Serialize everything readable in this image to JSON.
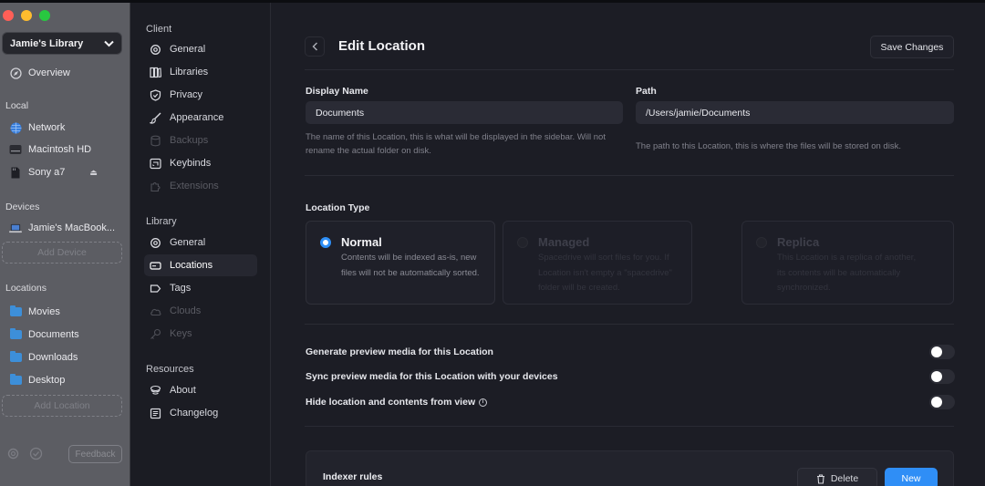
{
  "sidebar": {
    "library_name": "Jamie's Library",
    "overview": "Overview",
    "local_heading": "Local",
    "local_items": [
      "Network",
      "Macintosh HD",
      "Sony a7"
    ],
    "devices_heading": "Devices",
    "device_name": "Jamie's MacBook...",
    "add_device": "Add Device",
    "locations_heading": "Locations",
    "locations": [
      "Movies",
      "Documents",
      "Downloads",
      "Desktop"
    ],
    "add_location": "Add Location",
    "feedback": "Feedback"
  },
  "settings_nav": {
    "client_heading": "Client",
    "client_items": [
      "General",
      "Libraries",
      "Privacy",
      "Appearance",
      "Backups",
      "Keybinds",
      "Extensions"
    ],
    "library_heading": "Library",
    "library_items": [
      "General",
      "Locations",
      "Tags",
      "Clouds",
      "Keys"
    ],
    "resources_heading": "Resources",
    "resources_items": [
      "About",
      "Changelog"
    ]
  },
  "page": {
    "title": "Edit Location",
    "save_label": "Save Changes",
    "display_name_label": "Display Name",
    "display_name_value": "Documents",
    "display_name_help": "The name of this Location, this is what will be displayed in the sidebar. Will not rename the actual folder on disk.",
    "path_label": "Path",
    "path_value": "/Users/jamie/Documents",
    "path_help": "The path to this Location, this is where the files will be stored on disk.",
    "location_type_label": "Location Type",
    "types": [
      {
        "title": "Normal",
        "desc": "Contents will be indexed as-is, new files will not be automatically sorted.",
        "selected": true
      },
      {
        "title": "Managed",
        "desc": "Spacedrive will sort files for you. If Location isn't empty a \"spacedrive\" folder will be created.",
        "selected": false
      },
      {
        "title": "Replica",
        "desc": "This Location is a replica of another, its contents will be automatically synchronized.",
        "selected": false
      }
    ],
    "toggles": [
      {
        "label": "Generate preview media for this Location",
        "on": false
      },
      {
        "label": "Sync preview media for this Location with your devices",
        "on": false
      },
      {
        "label": "Hide location and contents from view",
        "on": false
      }
    ],
    "indexer_title": "Indexer rules",
    "delete_label": "Delete",
    "new_label": "New"
  },
  "colors": {
    "accent": "#2f8ef6",
    "folder": "#3d8fd9"
  }
}
